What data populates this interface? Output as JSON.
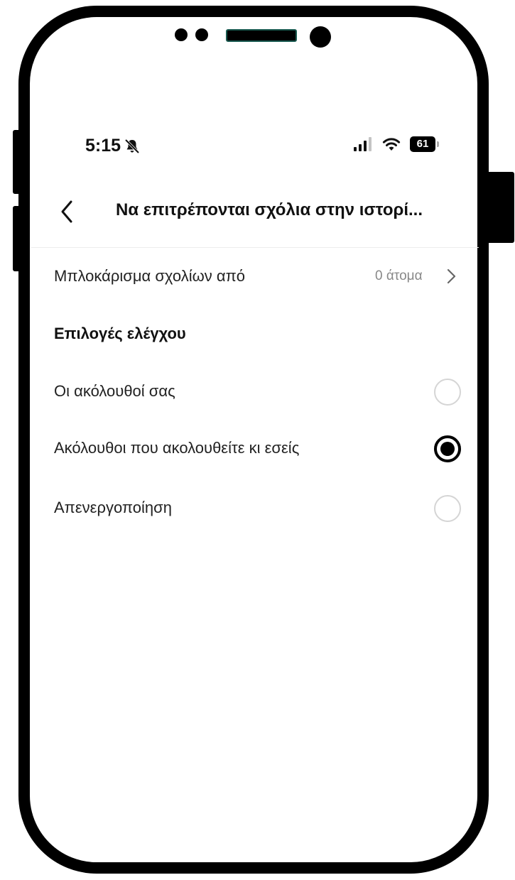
{
  "status_bar": {
    "time": "5:15",
    "battery": "61"
  },
  "header": {
    "title": "Να επιτρέπονται σχόλια στην ιστορί..."
  },
  "block_comments": {
    "label": "Μπλοκάρισμα σχολίων από",
    "value": "0 άτομα"
  },
  "controls": {
    "heading": "Επιλογές ελέγχου",
    "options": [
      {
        "label": "Οι ακόλουθοί σας",
        "selected": false
      },
      {
        "label": "Ακόλουθοι που ακολουθείτε κι εσείς",
        "selected": true
      },
      {
        "label": "Απενεργοποίηση",
        "selected": false
      }
    ]
  }
}
